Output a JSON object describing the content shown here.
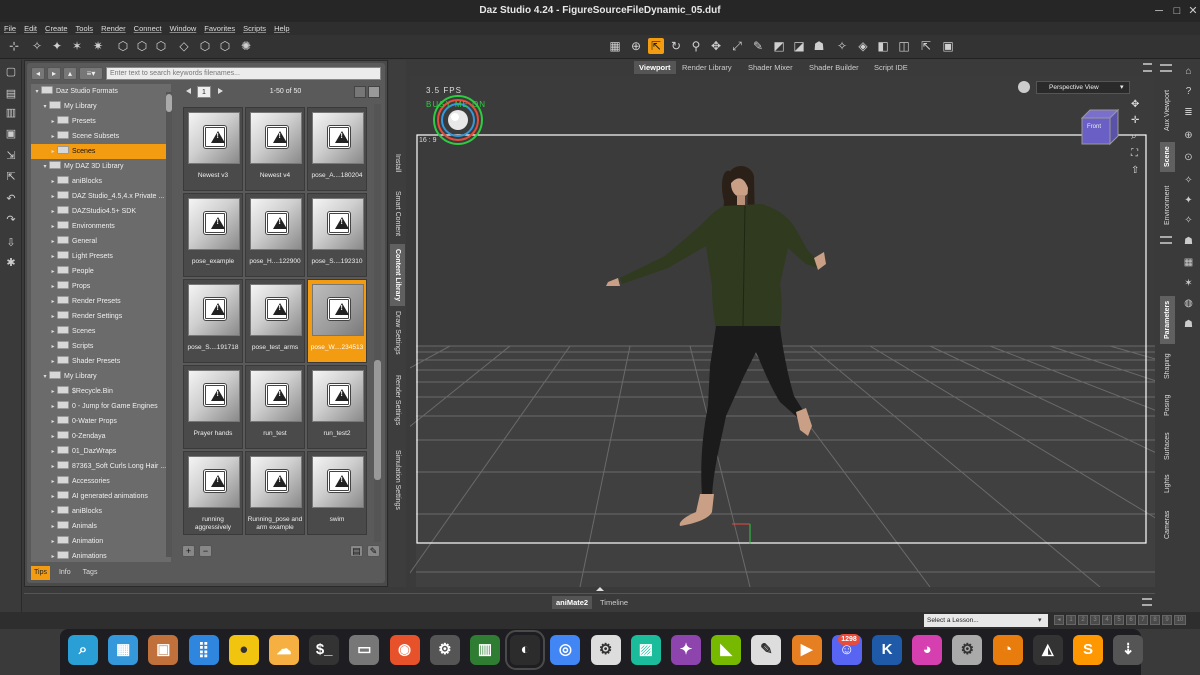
{
  "window": {
    "title": "Daz Studio 4.24 - FigureSourceFileDynamic_05.duf"
  },
  "menu": [
    "File",
    "Edit",
    "Create",
    "Tools",
    "Render",
    "Connect",
    "Window",
    "Favorites",
    "Scripts",
    "Help"
  ],
  "content_library": {
    "search_placeholder": "Enter text to search keywords filenames...",
    "page": "1",
    "page_info": "1-50 of 50",
    "tree": [
      {
        "label": "Daz Studio Formats",
        "level": 0,
        "open": true,
        "selected": false
      },
      {
        "label": "My Library",
        "level": 1,
        "open": true,
        "selected": false
      },
      {
        "label": "Presets",
        "level": 2,
        "open": false,
        "selected": false
      },
      {
        "label": "Scene Subsets",
        "level": 2,
        "open": false,
        "selected": false
      },
      {
        "label": "Scenes",
        "level": 2,
        "open": false,
        "selected": true
      },
      {
        "label": "My DAZ 3D Library",
        "level": 1,
        "open": true,
        "selected": false
      },
      {
        "label": "aniBlocks",
        "level": 2,
        "open": false,
        "selected": false
      },
      {
        "label": "DAZ Studio_4.5,4.x Private ...",
        "level": 2,
        "open": false,
        "selected": false
      },
      {
        "label": "DAZStudio4.5+ SDK",
        "level": 2,
        "open": false,
        "selected": false
      },
      {
        "label": "Environments",
        "level": 2,
        "open": false,
        "selected": false
      },
      {
        "label": "General",
        "level": 2,
        "open": false,
        "selected": false
      },
      {
        "label": "Light Presets",
        "level": 2,
        "open": false,
        "selected": false
      },
      {
        "label": "People",
        "level": 2,
        "open": false,
        "selected": false
      },
      {
        "label": "Props",
        "level": 2,
        "open": false,
        "selected": false
      },
      {
        "label": "Render Presets",
        "level": 2,
        "open": false,
        "selected": false
      },
      {
        "label": "Render Settings",
        "level": 2,
        "open": false,
        "selected": false
      },
      {
        "label": "Scenes",
        "level": 2,
        "open": false,
        "selected": false
      },
      {
        "label": "Scripts",
        "level": 2,
        "open": false,
        "selected": false
      },
      {
        "label": "Shader Presets",
        "level": 2,
        "open": false,
        "selected": false
      },
      {
        "label": "My Library",
        "level": 1,
        "open": true,
        "selected": false
      },
      {
        "label": "$Recycle.Bin",
        "level": 2,
        "open": false,
        "selected": false
      },
      {
        "label": "0 - Jump for Game Engines",
        "level": 2,
        "open": false,
        "selected": false
      },
      {
        "label": "0-Water Props",
        "level": 2,
        "open": false,
        "selected": false
      },
      {
        "label": "0-Zendaya",
        "level": 2,
        "open": false,
        "selected": false
      },
      {
        "label": "01_DazWraps",
        "level": 2,
        "open": false,
        "selected": false
      },
      {
        "label": "87363_Soft Curls Long Hair ...",
        "level": 2,
        "open": false,
        "selected": false
      },
      {
        "label": "Accessories",
        "level": 2,
        "open": false,
        "selected": false
      },
      {
        "label": "AI generated animations",
        "level": 2,
        "open": false,
        "selected": false
      },
      {
        "label": "aniBlocks",
        "level": 2,
        "open": false,
        "selected": false
      },
      {
        "label": "Animals",
        "level": 2,
        "open": false,
        "selected": false
      },
      {
        "label": "Animation",
        "level": 2,
        "open": false,
        "selected": false
      },
      {
        "label": "Animations",
        "level": 2,
        "open": false,
        "selected": false
      }
    ],
    "tiles": [
      {
        "label": "Newest v3",
        "selected": false
      },
      {
        "label": "Newest v4",
        "selected": false
      },
      {
        "label": "pose_A....180204",
        "selected": false
      },
      {
        "label": "pose_example",
        "selected": false
      },
      {
        "label": "pose_H....122900",
        "selected": false
      },
      {
        "label": "pose_S....192310",
        "selected": false
      },
      {
        "label": "pose_S....191718",
        "selected": false
      },
      {
        "label": "pose_test_arms",
        "selected": false
      },
      {
        "label": "pose_W....234513",
        "selected": true
      },
      {
        "label": "Prayer hands",
        "selected": false
      },
      {
        "label": "run_test",
        "selected": false
      },
      {
        "label": "run_test2",
        "selected": false
      },
      {
        "label": "running aggressively",
        "selected": false
      },
      {
        "label": "Running_pose and arm example",
        "selected": false
      },
      {
        "label": "swim",
        "selected": false
      }
    ],
    "footer_tabs": [
      {
        "label": "Tips",
        "active": true
      },
      {
        "label": "Info",
        "active": false
      },
      {
        "label": "Tags",
        "active": false
      }
    ]
  },
  "left_vtabs": [
    {
      "label": "Install",
      "active": false
    },
    {
      "label": "Smart Content",
      "active": false
    },
    {
      "label": "Content Library",
      "active": true
    },
    {
      "label": "Draw Settings",
      "active": false
    },
    {
      "label": "Render Settings",
      "active": false
    },
    {
      "label": "Simulation Settings",
      "active": false
    }
  ],
  "viewport_tabs": [
    {
      "label": "Viewport",
      "active": true
    },
    {
      "label": "Render Library",
      "active": false
    },
    {
      "label": "Shader Mixer",
      "active": false
    },
    {
      "label": "Shader Builder",
      "active": false
    },
    {
      "label": "Script IDE",
      "active": false
    }
  ],
  "viewport": {
    "fps": "3.5 FPS",
    "overlay_text": "BUSY ME ON",
    "aspect": "16 : 9",
    "view": "Perspective View",
    "cube_label": "Front"
  },
  "right_tabs_top": [
    {
      "label": "Aux Viewport",
      "active": false
    },
    {
      "label": "Scene",
      "active": true
    },
    {
      "label": "Environment",
      "active": false
    }
  ],
  "right_tabs_bottom": [
    {
      "label": "Parameters",
      "active": true
    },
    {
      "label": "Shaping",
      "active": false
    },
    {
      "label": "Posing",
      "active": false
    },
    {
      "label": "Surfaces",
      "active": false
    },
    {
      "label": "Lights",
      "active": false
    },
    {
      "label": "Cameras",
      "active": false
    }
  ],
  "bottom_tabs": [
    {
      "label": "aniMate2",
      "active": true
    },
    {
      "label": "Timeline",
      "active": false
    }
  ],
  "lesson": {
    "placeholder": "Select a Lesson...",
    "pages": [
      "1",
      "2",
      "3",
      "4",
      "5",
      "6",
      "7",
      "8",
      "9",
      "10"
    ]
  },
  "taskbar": {
    "apps": [
      {
        "name": "search-app",
        "glyph": "⌕",
        "color": "#2a9fd6"
      },
      {
        "name": "files-app",
        "glyph": "▦",
        "color": "#3498db"
      },
      {
        "name": "archive-app",
        "glyph": "▣",
        "color": "#c0703a"
      },
      {
        "name": "apps-grid",
        "glyph": "⣿",
        "color": "#2e86de"
      },
      {
        "name": "circle-app",
        "glyph": "●",
        "color": "#f1c40f"
      },
      {
        "name": "weather-app",
        "glyph": "☁",
        "color": "#f5b041"
      },
      {
        "name": "terminal-app",
        "glyph": "$_",
        "color": "#333"
      },
      {
        "name": "file-manager",
        "glyph": "▭",
        "color": "#777"
      },
      {
        "name": "firefox",
        "glyph": "◉",
        "color": "#e8522b"
      },
      {
        "name": "settings-app",
        "glyph": "⚙",
        "color": "#555"
      },
      {
        "name": "archive-manager",
        "glyph": "▥",
        "color": "#2e7d32"
      },
      {
        "name": "daz-studio",
        "glyph": "◐",
        "color": "#2c2c2c"
      },
      {
        "name": "chrome",
        "glyph": "◎",
        "color": "#4285f4"
      },
      {
        "name": "document-settings",
        "glyph": "⚙",
        "color": "#ddd"
      },
      {
        "name": "image-viewer",
        "glyph": "▨",
        "color": "#1abc9c"
      },
      {
        "name": "copilot",
        "glyph": "✦",
        "color": "#8e44ad"
      },
      {
        "name": "nvidia",
        "glyph": "◣",
        "color": "#76b900"
      },
      {
        "name": "text-editor",
        "glyph": "✎",
        "color": "#ddd"
      },
      {
        "name": "video-editor",
        "glyph": "▶",
        "color": "#e67e22"
      },
      {
        "name": "discord",
        "glyph": "☺",
        "color": "#5865f2"
      },
      {
        "name": "krita",
        "glyph": "K",
        "color": "#1e5aa8"
      },
      {
        "name": "color-app",
        "glyph": "◕",
        "color": "#d63fb0"
      },
      {
        "name": "config-app",
        "glyph": "⚙",
        "color": "#aaa"
      },
      {
        "name": "blender",
        "glyph": "◔",
        "color": "#e87d0d"
      },
      {
        "name": "vector-app",
        "glyph": "◭",
        "color": "#333"
      },
      {
        "name": "sublime",
        "glyph": "S",
        "color": "#ff9800"
      },
      {
        "name": "usb-app",
        "glyph": "⇣",
        "color": "#555"
      }
    ],
    "discord_badge": "1298"
  },
  "colors": {
    "accent": "#f39c12",
    "viewport_bg": "#3b3b3b",
    "grid": "#5a5a5a"
  }
}
